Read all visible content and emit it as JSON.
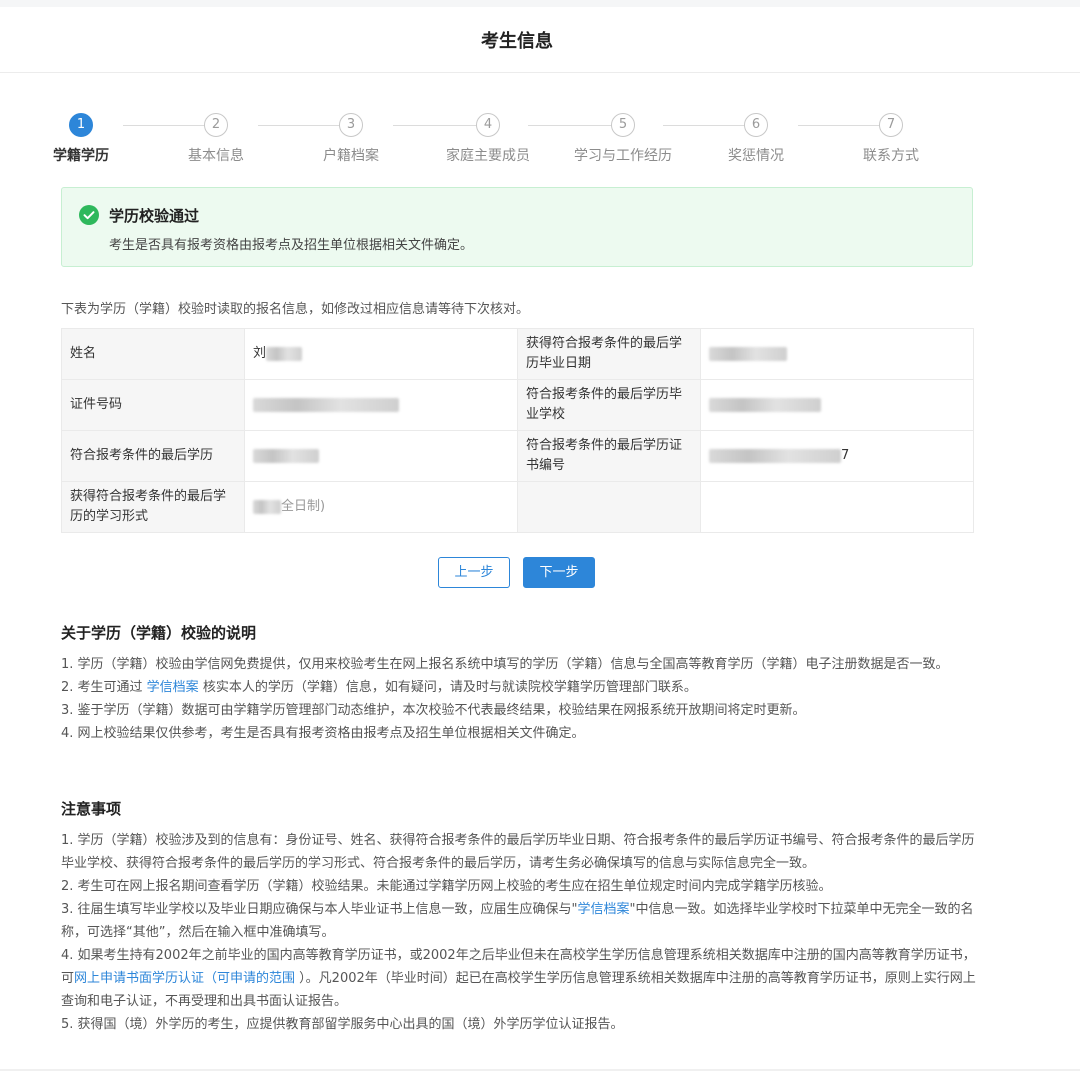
{
  "page": {
    "title": "考生信息"
  },
  "steps": [
    {
      "num": "1",
      "label": "学籍学历",
      "active": true
    },
    {
      "num": "2",
      "label": "基本信息",
      "active": false
    },
    {
      "num": "3",
      "label": "户籍档案",
      "active": false
    },
    {
      "num": "4",
      "label": "家庭主要成员",
      "active": false
    },
    {
      "num": "5",
      "label": "学习与工作经历",
      "active": false
    },
    {
      "num": "6",
      "label": "奖惩情况",
      "active": false
    },
    {
      "num": "7",
      "label": "联系方式",
      "active": false
    }
  ],
  "alert": {
    "title": "学历校验通过",
    "description": "考生是否具有报考资格由报考点及招生单位根据相关文件确定。"
  },
  "intro": "下表为学历（学籍）校验时读取的报名信息，如修改过相应信息请等待下次核对。",
  "table": {
    "rows": [
      {
        "l1": "姓名",
        "v1": "刘",
        "l2": "获得符合报考条件的最后学历毕业日期",
        "v2": ""
      },
      {
        "l1": "证件号码",
        "v1": "",
        "l2": "符合报考条件的最后学历毕业学校",
        "v2": ""
      },
      {
        "l1": "符合报考条件的最后学历",
        "v1": "",
        "l2": "符合报考条件的最后学历证书编号",
        "v2": "7"
      },
      {
        "l1": "获得符合报考条件的最后学历的学习形式",
        "v1": "全日制)",
        "l2": "",
        "v2": ""
      }
    ]
  },
  "buttons": {
    "prev": "上一步",
    "next": "下一步"
  },
  "verify_notes": {
    "title": "关于学历（学籍）校验的说明",
    "p1": "1. 学历（学籍）校验由学信网免费提供，仅用来校验考生在网上报名系统中填写的学历（学籍）信息与全国高等教育学历（学籍）电子注册数据是否一致。",
    "p2_before": "2. 考生可通过 ",
    "p2_link": "学信档案",
    "p2_after": " 核实本人的学历（学籍）信息，如有疑问，请及时与就读院校学籍学历管理部门联系。",
    "p3": "3. 鉴于学历（学籍）数据可由学籍学历管理部门动态维护，本次校验不代表最终结果，校验结果在网报系统开放期间将定时更新。",
    "p4": "4. 网上校验结果仅供参考，考生是否具有报考资格由报考点及招生单位根据相关文件确定。"
  },
  "attention": {
    "title": "注意事项",
    "p1": "1. 学历（学籍）校验涉及到的信息有：身份证号、姓名、获得符合报考条件的最后学历毕业日期、符合报考条件的最后学历证书编号、符合报考条件的最后学历毕业学校、获得符合报考条件的最后学历的学习形式、符合报考条件的最后学历，请考生务必确保填写的信息与实际信息完全一致。",
    "p2": "2. 考生可在网上报名期间查看学历（学籍）校验结果。未能通过学籍学历网上校验的考生应在招生单位规定时间内完成学籍学历核验。",
    "p3_before": "3. 往届生填写毕业学校以及毕业日期应确保与本人毕业证书上信息一致，应届生应确保与\"",
    "p3_link": "学信档案",
    "p3_after": "\"中信息一致。如选择毕业学校时下拉菜单中无完全一致的名称，可选择“其他”，然后在输入框中准确填写。",
    "p4_before": "4. 如果考生持有2002年之前毕业的国内高等教育学历证书，或2002年之后毕业但未在高校学生学历信息管理系统相关数据库中注册的国内高等教育学历证书，可",
    "p4_link1": "网上申请书面学历认证",
    "p4_link2": "（可申请的范围",
    "p4_after": " ）。凡2002年（毕业时间）起已在高校学生学历信息管理系统相关数据库中注册的高等教育学历证书，原则上实行网上查询和电子认证，不再受理和出具书面认证报告。",
    "p5": "5. 获得国（境）外学历的考生，应提供教育部留学服务中心出具的国（境）外学历学位认证报告。"
  }
}
